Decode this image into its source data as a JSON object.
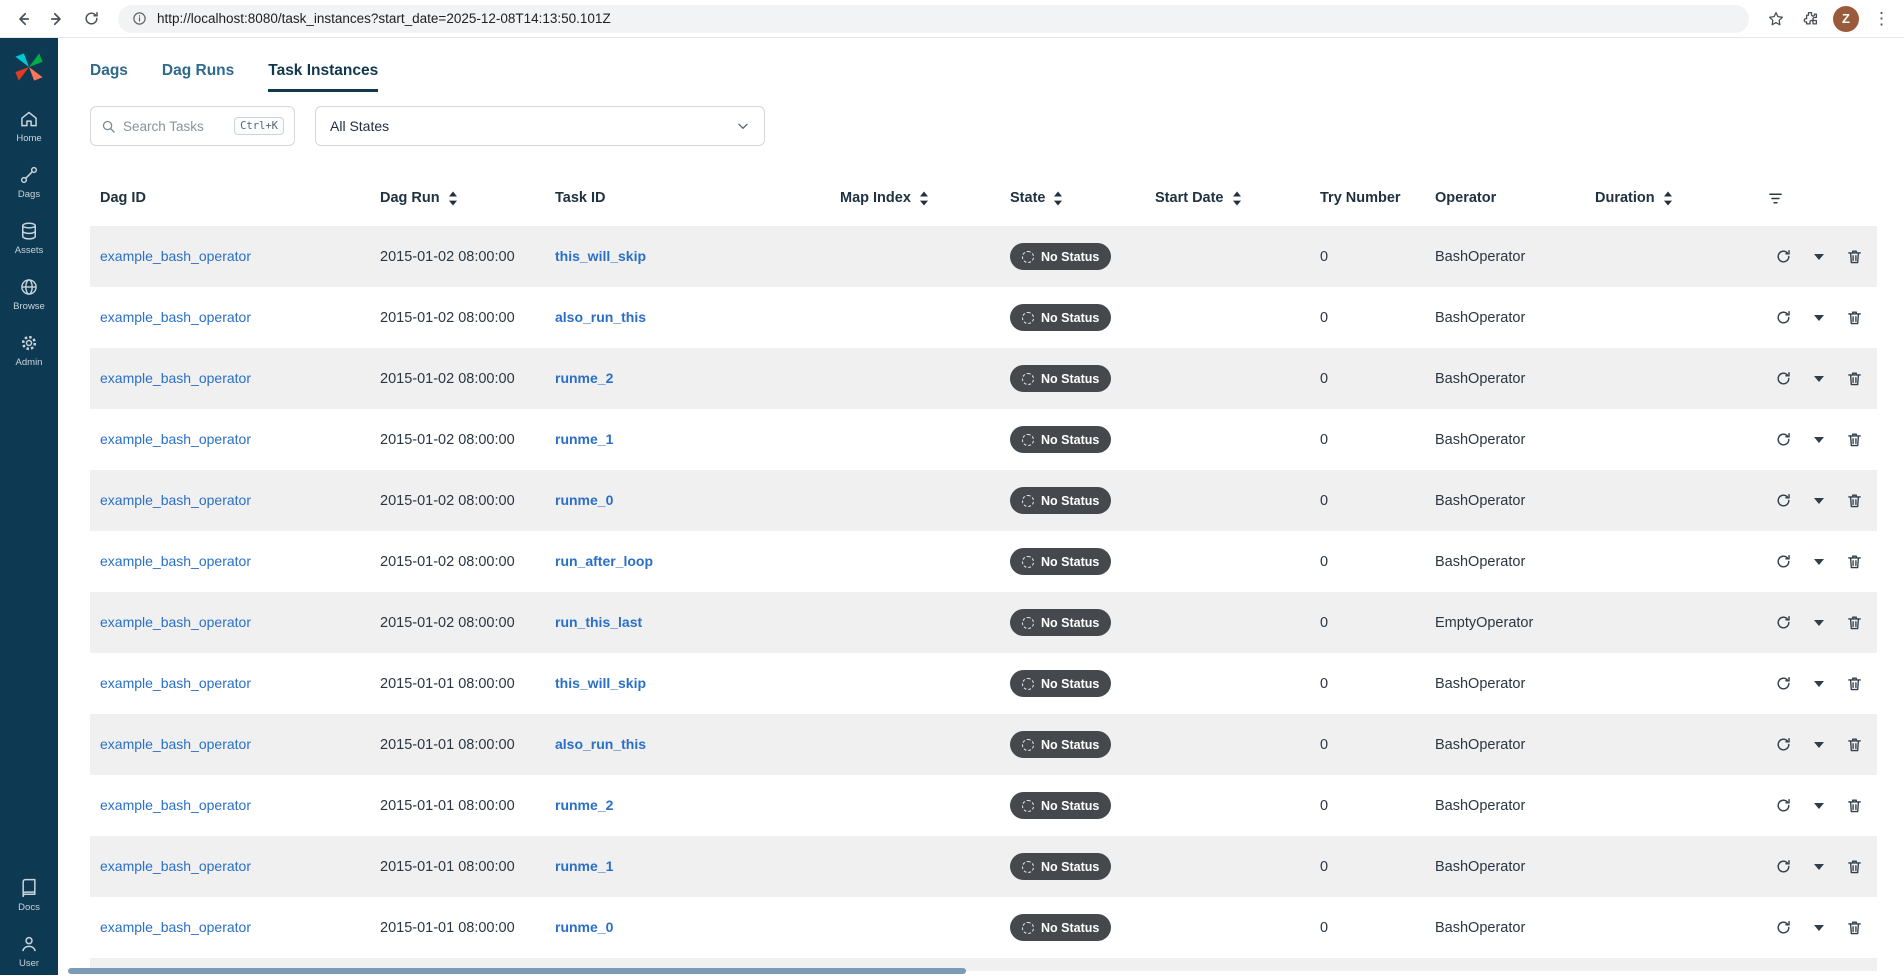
{
  "browser": {
    "url": "http://localhost:8080/task_instances?start_date=2025-12-08T14:13:50.101Z",
    "avatar_initial": "Z"
  },
  "sidebar": {
    "items": [
      {
        "label": "Home"
      },
      {
        "label": "Dags"
      },
      {
        "label": "Assets"
      },
      {
        "label": "Browse"
      },
      {
        "label": "Admin"
      }
    ],
    "bottom_items": [
      {
        "label": "Docs"
      },
      {
        "label": "User"
      }
    ]
  },
  "tabs": [
    {
      "label": "Dags"
    },
    {
      "label": "Dag Runs"
    },
    {
      "label": "Task Instances"
    }
  ],
  "toolbar": {
    "search_placeholder": "Search Tasks",
    "search_shortcut": "Ctrl+K",
    "states_filter_value": "All States"
  },
  "table": {
    "columns": [
      {
        "label": "Dag ID",
        "sortable": false
      },
      {
        "label": "Dag Run",
        "sortable": true
      },
      {
        "label": "Task ID",
        "sortable": false
      },
      {
        "label": "Map Index",
        "sortable": true
      },
      {
        "label": "State",
        "sortable": true
      },
      {
        "label": "Start Date",
        "sortable": true
      },
      {
        "label": "Try Number",
        "sortable": false
      },
      {
        "label": "Operator",
        "sortable": false
      },
      {
        "label": "Duration",
        "sortable": true
      }
    ],
    "rows": [
      {
        "dag_id": "example_bash_operator",
        "dag_run": "2015-01-02 08:00:00",
        "task_id": "this_will_skip",
        "map_index": "",
        "state": "No Status",
        "start_date": "",
        "try_number": "0",
        "operator": "BashOperator",
        "duration": ""
      },
      {
        "dag_id": "example_bash_operator",
        "dag_run": "2015-01-02 08:00:00",
        "task_id": "also_run_this",
        "map_index": "",
        "state": "No Status",
        "start_date": "",
        "try_number": "0",
        "operator": "BashOperator",
        "duration": ""
      },
      {
        "dag_id": "example_bash_operator",
        "dag_run": "2015-01-02 08:00:00",
        "task_id": "runme_2",
        "map_index": "",
        "state": "No Status",
        "start_date": "",
        "try_number": "0",
        "operator": "BashOperator",
        "duration": ""
      },
      {
        "dag_id": "example_bash_operator",
        "dag_run": "2015-01-02 08:00:00",
        "task_id": "runme_1",
        "map_index": "",
        "state": "No Status",
        "start_date": "",
        "try_number": "0",
        "operator": "BashOperator",
        "duration": ""
      },
      {
        "dag_id": "example_bash_operator",
        "dag_run": "2015-01-02 08:00:00",
        "task_id": "runme_0",
        "map_index": "",
        "state": "No Status",
        "start_date": "",
        "try_number": "0",
        "operator": "BashOperator",
        "duration": ""
      },
      {
        "dag_id": "example_bash_operator",
        "dag_run": "2015-01-02 08:00:00",
        "task_id": "run_after_loop",
        "map_index": "",
        "state": "No Status",
        "start_date": "",
        "try_number": "0",
        "operator": "BashOperator",
        "duration": ""
      },
      {
        "dag_id": "example_bash_operator",
        "dag_run": "2015-01-02 08:00:00",
        "task_id": "run_this_last",
        "map_index": "",
        "state": "No Status",
        "start_date": "",
        "try_number": "0",
        "operator": "EmptyOperator",
        "duration": ""
      },
      {
        "dag_id": "example_bash_operator",
        "dag_run": "2015-01-01 08:00:00",
        "task_id": "this_will_skip",
        "map_index": "",
        "state": "No Status",
        "start_date": "",
        "try_number": "0",
        "operator": "BashOperator",
        "duration": ""
      },
      {
        "dag_id": "example_bash_operator",
        "dag_run": "2015-01-01 08:00:00",
        "task_id": "also_run_this",
        "map_index": "",
        "state": "No Status",
        "start_date": "",
        "try_number": "0",
        "operator": "BashOperator",
        "duration": ""
      },
      {
        "dag_id": "example_bash_operator",
        "dag_run": "2015-01-01 08:00:00",
        "task_id": "runme_2",
        "map_index": "",
        "state": "No Status",
        "start_date": "",
        "try_number": "0",
        "operator": "BashOperator",
        "duration": ""
      },
      {
        "dag_id": "example_bash_operator",
        "dag_run": "2015-01-01 08:00:00",
        "task_id": "runme_1",
        "map_index": "",
        "state": "No Status",
        "start_date": "",
        "try_number": "0",
        "operator": "BashOperator",
        "duration": ""
      },
      {
        "dag_id": "example_bash_operator",
        "dag_run": "2015-01-01 08:00:00",
        "task_id": "runme_0",
        "map_index": "",
        "state": "No Status",
        "start_date": "",
        "try_number": "0",
        "operator": "BashOperator",
        "duration": ""
      }
    ]
  },
  "colors": {
    "sidebar_bg": "#0d3a52",
    "link_blue": "#2a6fc7",
    "badge_bg": "#45494e",
    "row_stripe": "#f0f0f1",
    "active_tab": "#10394f",
    "avatar_bg": "#9a5b3c"
  }
}
